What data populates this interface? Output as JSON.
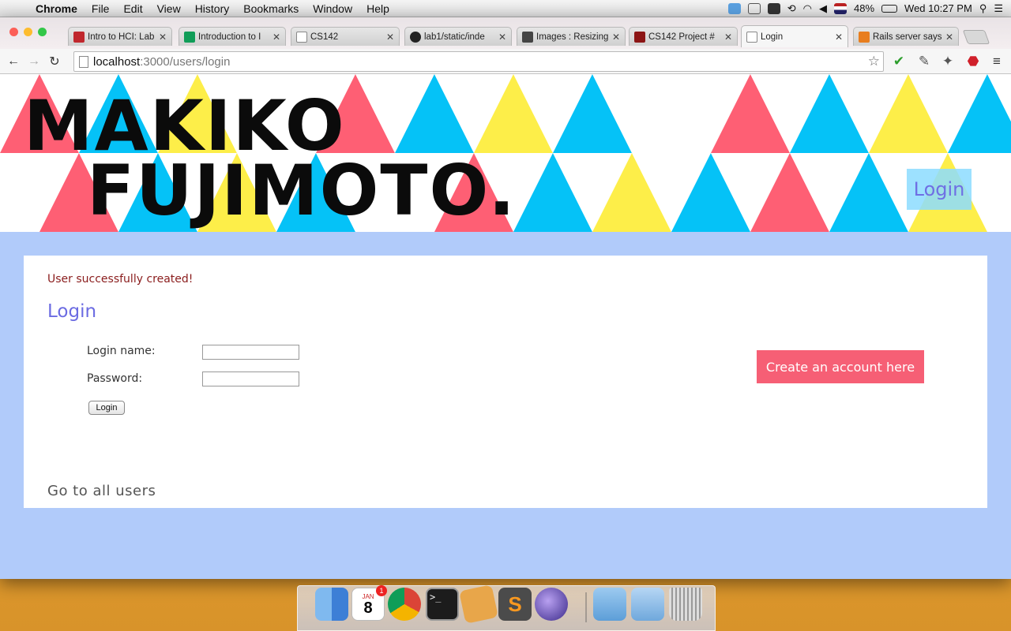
{
  "menubar": {
    "app": "Chrome",
    "menus": [
      "File",
      "Edit",
      "View",
      "History",
      "Bookmarks",
      "Window",
      "Help"
    ],
    "battery": "48%",
    "clock": "Wed 10:27 PM"
  },
  "tabs": [
    {
      "title": "Intro to HCI: Lab",
      "favicon_color": "#c0272d"
    },
    {
      "title": "Introduction to I",
      "favicon_color": "#109d58"
    },
    {
      "title": "CS142",
      "favicon_color": "#ffffff"
    },
    {
      "title": "lab1/static/inde",
      "favicon_color": "#222222"
    },
    {
      "title": "Images : Resizing",
      "favicon_color": "#444444"
    },
    {
      "title": "CS142 Project #",
      "favicon_color": "#8c1515"
    },
    {
      "title": "Login",
      "favicon_color": "#ffffff"
    },
    {
      "title": "Rails server says",
      "favicon_color": "#e87d1e"
    }
  ],
  "address": {
    "host": "localhost",
    "path": ":3000/users/login"
  },
  "banner": {
    "logo_line1": "MAKIKO",
    "logo_line2": "FUJIMOTO",
    "logo_dot": ".",
    "nav_login": "Login",
    "colors": {
      "blue": "#05c2f7",
      "pink": "#fe5f74",
      "yellow": "#fdee49"
    }
  },
  "main": {
    "flash": "User successfully created!",
    "heading": "Login",
    "login_name_label": "Login name:",
    "password_label": "Password:",
    "submit_label": "Login",
    "create_account": "Create an account here",
    "all_users_link": "Go to all users"
  },
  "dock": {
    "calendar_day": "8",
    "calendar_month": "JAN",
    "calendar_badge": "1"
  }
}
